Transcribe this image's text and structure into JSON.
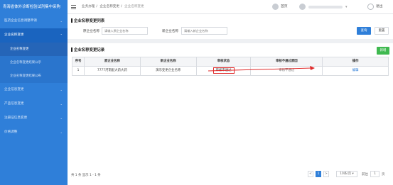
{
  "app": {
    "title": "青海省体外诊断检验试剂集中采购"
  },
  "header": {
    "breadcrumb": [
      "业务办理",
      "企业名称变更",
      "企业名称变更"
    ],
    "home_label": "首页",
    "user_label": "",
    "exit_label": "退出"
  },
  "sidebar": {
    "items": [
      {
        "label": "医药企业信息调整申请"
      },
      {
        "label": "企业名称变更"
      },
      {
        "label": "企业信息变更"
      },
      {
        "label": "产品信息变更"
      },
      {
        "label": "注册证信息变更"
      },
      {
        "label": "价格调整"
      }
    ],
    "subitems": [
      {
        "label": "企业名称变更"
      },
      {
        "label": "企业名称变更结果公示"
      },
      {
        "label": "企业名称变更结果公布"
      }
    ]
  },
  "search": {
    "title": "企业名称变更列表",
    "orig_label": "原企业名称",
    "orig_placeholder": "请输入原企业名称",
    "new_label": "新企业名称",
    "new_placeholder": "请输入新企业名称",
    "search_btn": "查询",
    "reset_btn": "重置"
  },
  "records": {
    "title": "企业名称变更记录",
    "add_btn": "新增",
    "columns": [
      "序号",
      "原企业名称",
      "新企业名称",
      "审核状态",
      "审核不通过原因",
      "操作"
    ],
    "rows": [
      {
        "index": "1",
        "orig_name": "7777河南配大药大药",
        "new_name": "演示变更企业名称",
        "status": "审核不通过",
        "reason": "审核不通过",
        "action": "编辑"
      }
    ]
  },
  "pagination": {
    "summary": "共 1 条  显示 1 - 1 条",
    "prev": "<",
    "current": "1",
    "next": ">",
    "page_size": "10条/页",
    "goto_label": "前往",
    "goto_value": "1",
    "goto_unit": "页"
  },
  "colors": {
    "accent": "#2f7fd9",
    "sidebar_active": "#1a64bf",
    "add_green": "#3fb950",
    "annotation_red": "#e02a2a"
  }
}
